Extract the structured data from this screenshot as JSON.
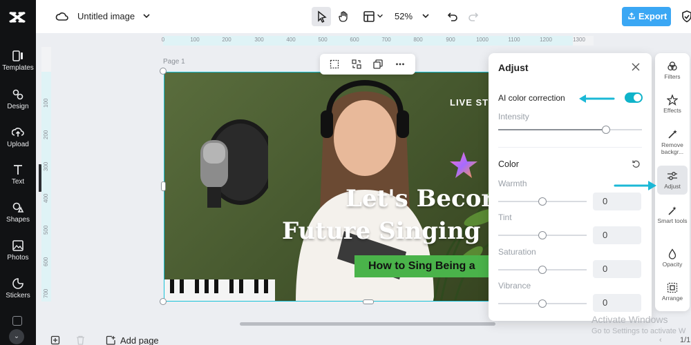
{
  "app": {
    "title": "Untitled image",
    "zoom": "52%",
    "export_label": "Export"
  },
  "leftbar": {
    "items": [
      {
        "label": "Templates",
        "icon": "templates-icon"
      },
      {
        "label": "Design",
        "icon": "design-icon"
      },
      {
        "label": "Upload",
        "icon": "upload-icon"
      },
      {
        "label": "Text",
        "icon": "text-icon"
      },
      {
        "label": "Shapes",
        "icon": "shapes-icon"
      },
      {
        "label": "Photos",
        "icon": "photos-icon"
      },
      {
        "label": "Stickers",
        "icon": "stickers-icon"
      }
    ]
  },
  "ruler": {
    "top_ticks": [
      "0",
      "100",
      "200",
      "300",
      "400",
      "500",
      "600",
      "700",
      "800",
      "900",
      "1000",
      "1100",
      "1200",
      "1300"
    ],
    "left_ticks": [
      "100",
      "200",
      "300",
      "400",
      "500",
      "600",
      "700"
    ]
  },
  "canvas": {
    "page_label": "Page 1",
    "live_text": "LIVE ST",
    "headline_1": "Let's Becor",
    "headline_2": "Future Singing",
    "subheadline": "How to Sing Being a"
  },
  "adjust_panel": {
    "title": "Adjust",
    "ai_color_correction": {
      "label": "AI color correction",
      "enabled": true
    },
    "intensity": {
      "label": "Intensity",
      "value_fraction": 0.75
    },
    "color_section": "Color",
    "sliders": [
      {
        "label": "Warmth",
        "value": "0"
      },
      {
        "label": "Tint",
        "value": "0"
      },
      {
        "label": "Saturation",
        "value": "0"
      },
      {
        "label": "Vibrance",
        "value": "0"
      }
    ]
  },
  "rightbar": {
    "items": [
      {
        "label": "Filters",
        "icon": "filters-icon"
      },
      {
        "label": "Effects",
        "icon": "effects-icon"
      },
      {
        "label": "Remove backgr...",
        "icon": "remove-background-icon"
      },
      {
        "label": "Adjust",
        "icon": "adjust-icon",
        "active": true
      },
      {
        "label": "Smart tools",
        "icon": "smart-tools-icon"
      },
      {
        "label": "Opacity",
        "icon": "opacity-icon"
      },
      {
        "label": "Arrange",
        "icon": "arrange-icon"
      }
    ]
  },
  "bottombar": {
    "add_page": "Add page",
    "page_count": "1/1"
  },
  "watermark": {
    "line1": "Activate Windows",
    "line2": "Go to Settings to activate W"
  },
  "colors": {
    "accent": "#0fb3c9",
    "export": "#3aa7f4",
    "selection": "#16c1d8",
    "arrow": "#1bb8d6",
    "sidebar": "#111214"
  }
}
